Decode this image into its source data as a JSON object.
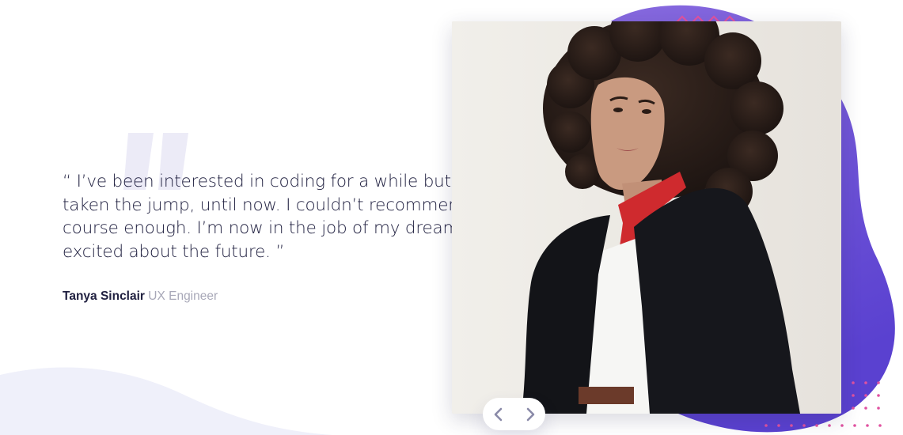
{
  "testimonial": {
    "quote": "“ I’ve been interested in coding for a while but never taken the jump, until now. I couldn’t recommend this course enough. I’m now in the job of my dreams and so excited about the future. ”",
    "author_name": "Tanya Sinclair",
    "author_role": "UX Engineer"
  },
  "photo": {
    "alt": "Tanya Sinclair"
  },
  "navigation": {
    "prev_icon": "chevron-left-icon",
    "next_icon": "chevron-right-icon"
  },
  "colors": {
    "text_dark": "#202040",
    "text_muted": "#a8a8b8",
    "accent_purple": "#6c50d6",
    "accent_pink": "#e052a0",
    "curve_light": "#eff0fa"
  }
}
